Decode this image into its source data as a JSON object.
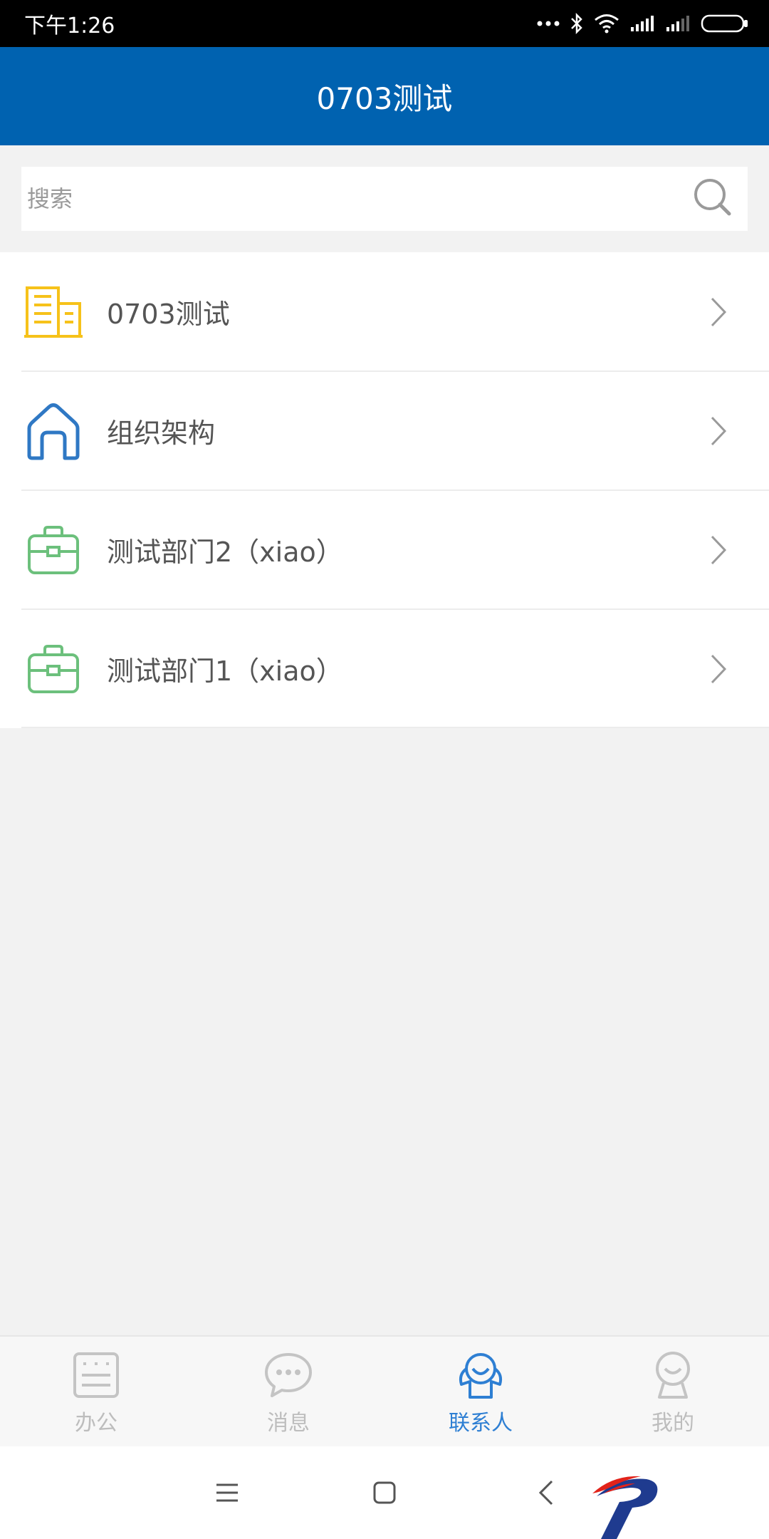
{
  "status_bar": {
    "time": "下午1:26"
  },
  "header": {
    "title": "0703测试"
  },
  "search": {
    "placeholder": "搜索"
  },
  "list": {
    "items": [
      {
        "label": "0703测试",
        "icon": "building-icon",
        "color": "#f6c21a"
      },
      {
        "label": "组织架构",
        "icon": "house-icon",
        "color": "#2f78c4"
      },
      {
        "label": "测试部门2（xiao）",
        "icon": "briefcase-icon",
        "color": "#6cc07c"
      },
      {
        "label": "测试部门1（xiao）",
        "icon": "briefcase-icon",
        "color": "#6cc07c"
      }
    ]
  },
  "tabs": [
    {
      "label": "办公",
      "icon": "office-icon",
      "active": false
    },
    {
      "label": "消息",
      "icon": "chat-icon",
      "active": false
    },
    {
      "label": "联系人",
      "icon": "contacts-icon",
      "active": true
    },
    {
      "label": "我的",
      "icon": "profile-icon",
      "active": false
    }
  ],
  "colors": {
    "header_bg": "#0062b0",
    "active_tab": "#2e7fd3",
    "inactive_tab": "#bdbdbd"
  }
}
